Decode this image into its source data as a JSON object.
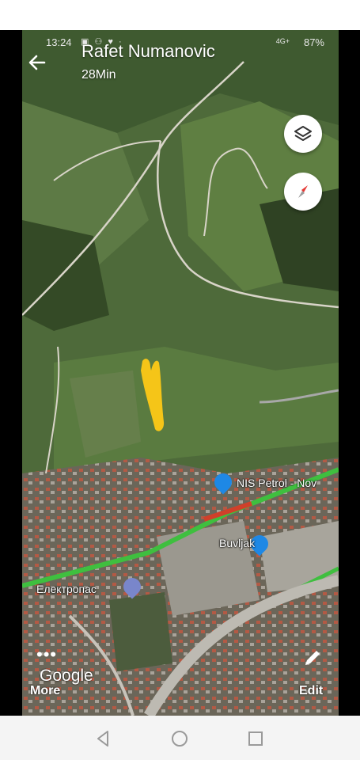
{
  "status_bar": {
    "time": "13:24",
    "network": "4G+",
    "battery": "87%"
  },
  "header": {
    "title": "Rafet Numanovic",
    "subtitle": "28Min",
    "back_icon": "arrow-left-icon"
  },
  "map_controls": {
    "layers_icon": "layers-icon",
    "compass_icon": "compass-icon"
  },
  "map_labels": {
    "fuel_station": "NIS Petrol - Nov",
    "shop": "Buvljak",
    "electro": "Електропас"
  },
  "bottom_bar": {
    "more_dots": "•••",
    "brand": "Google",
    "more_label": "More",
    "edit_label": "Edit"
  },
  "colors": {
    "highlight": "#f5c518",
    "road_green": "#3fbf3f",
    "road_red": "#d0402a"
  }
}
